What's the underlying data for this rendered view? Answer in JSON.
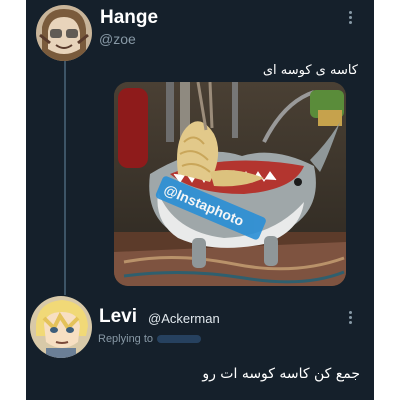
{
  "tweet": {
    "author_name": "Hange",
    "author_handle": "@zoe",
    "text": "کاسه ی کوسه ای",
    "image_watermark": "@Instaphoto"
  },
  "reply": {
    "author_name": "Levi",
    "author_handle": "@Ackerman",
    "replying_to_label": "Replying to",
    "text": "جمع کن کاسه کوسه ات رو"
  },
  "icons": {
    "more": "more-vertical-icon"
  },
  "colors": {
    "background": "#15202b",
    "text_primary": "#ffffff",
    "text_secondary": "#8899a6",
    "watermark_bg": "#2a8fd6"
  }
}
